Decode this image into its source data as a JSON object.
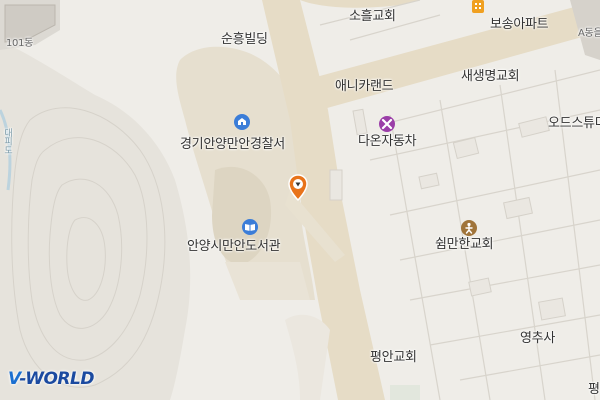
{
  "map": {
    "labels": {
      "building_101": "101동",
      "soonheung": "순흥빌딩",
      "soheul_church": "소흘교회",
      "bosong_apt": "보송아파트",
      "a_dong": "A동을",
      "annie_candy": "애니카랜드",
      "saesaengmyeong": "새생명교회",
      "police": "경기안양만안경찰서",
      "daon_motors": "다온자동차",
      "ods": "오드스튜디",
      "library": "안양시만안도서관",
      "swimanhan": "쉼만한교회",
      "yeongchusa": "영추사",
      "pyeongan_church": "평안교회",
      "left_edge": "대피도",
      "corner_bottom_right": "평"
    },
    "icons": [
      "police-icon",
      "library-icon",
      "repair-icon",
      "church-icon",
      "apartment-icon",
      "location-marker-icon"
    ],
    "colors": {
      "background": "#efede8",
      "road": "#e6dcc6",
      "hill": "#e4e1da",
      "contour": "#d4d0c8",
      "poi_blue": "#3b7dd8",
      "poi_purple": "#9b3ea8",
      "poi_brown": "#a0743a",
      "poi_orange": "#f0a020",
      "marker": "#e8731a",
      "watermark": "#1b4aa0"
    },
    "watermark": {
      "prefix": "V",
      "text": "-WORLD"
    }
  }
}
